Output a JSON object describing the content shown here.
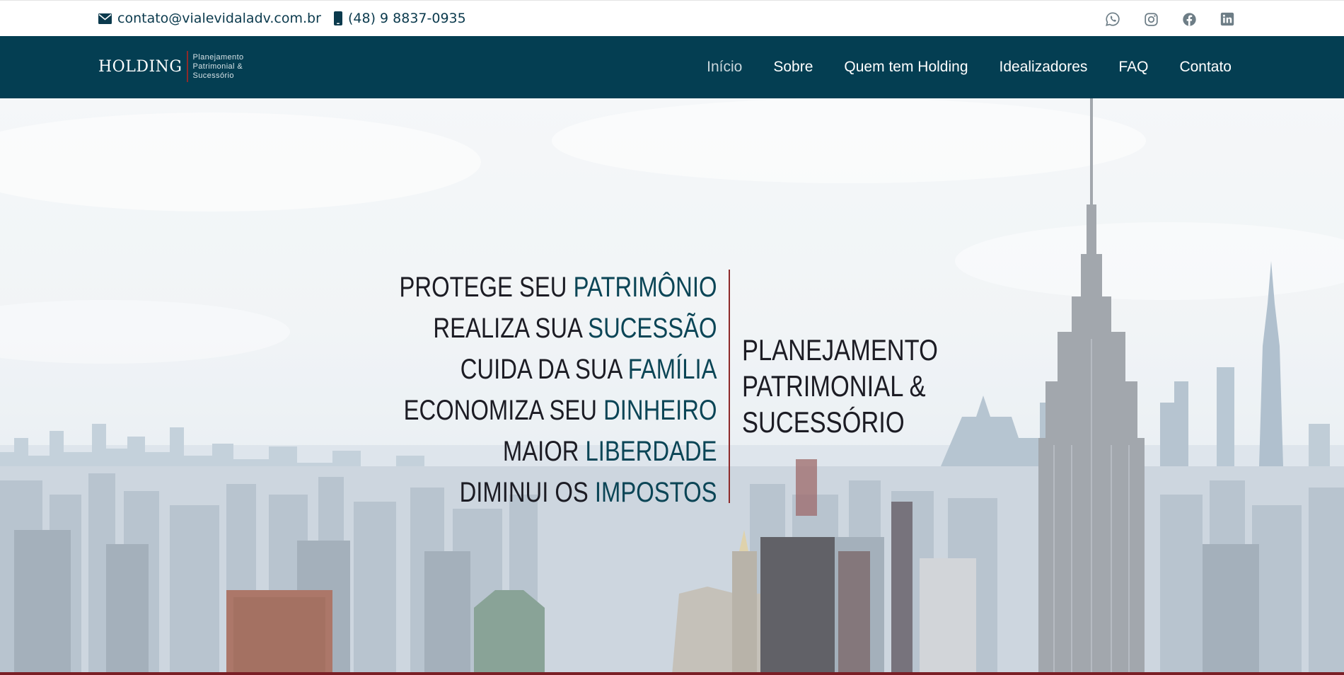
{
  "topbar": {
    "email": "contato@vialevidaladv.com.br",
    "phone": "(48) 9 8837-0935",
    "socials": [
      "whatsapp-icon",
      "instagram-icon",
      "facebook-icon",
      "linkedin-icon"
    ]
  },
  "logo": {
    "word": "HOLDING",
    "sub_line1": "Planejamento",
    "sub_line2": "Patrimonial &",
    "sub_line3": "Sucessório"
  },
  "nav": {
    "items": [
      {
        "label": "Início",
        "active": true
      },
      {
        "label": "Sobre"
      },
      {
        "label": "Quem tem Holding"
      },
      {
        "label": "Idealizadores"
      },
      {
        "label": "FAQ"
      },
      {
        "label": "Contato"
      }
    ]
  },
  "hero": {
    "taglines": [
      {
        "prefix": "PROTEGE SEU ",
        "highlight": "PATRIMÔNIO"
      },
      {
        "prefix": "REALIZA SUA ",
        "highlight": "SUCESSÃO"
      },
      {
        "prefix": "CUIDA DA SUA ",
        "highlight": "FAMÍLIA"
      },
      {
        "prefix": "ECONOMIZA SEU ",
        "highlight": "DINHEIRO"
      },
      {
        "prefix": "MAIOR ",
        "highlight": "LIBERDADE"
      },
      {
        "prefix": "DIMINUI OS ",
        "highlight": "IMPOSTOS"
      }
    ],
    "side_title": [
      "PLANEJAMENTO",
      "PATRIMONIAL &",
      "SUCESSÓRIO"
    ]
  },
  "colors": {
    "brand_dark": "#043e52",
    "highlight": "#0b4556",
    "accent_red": "#8e2a2a"
  }
}
